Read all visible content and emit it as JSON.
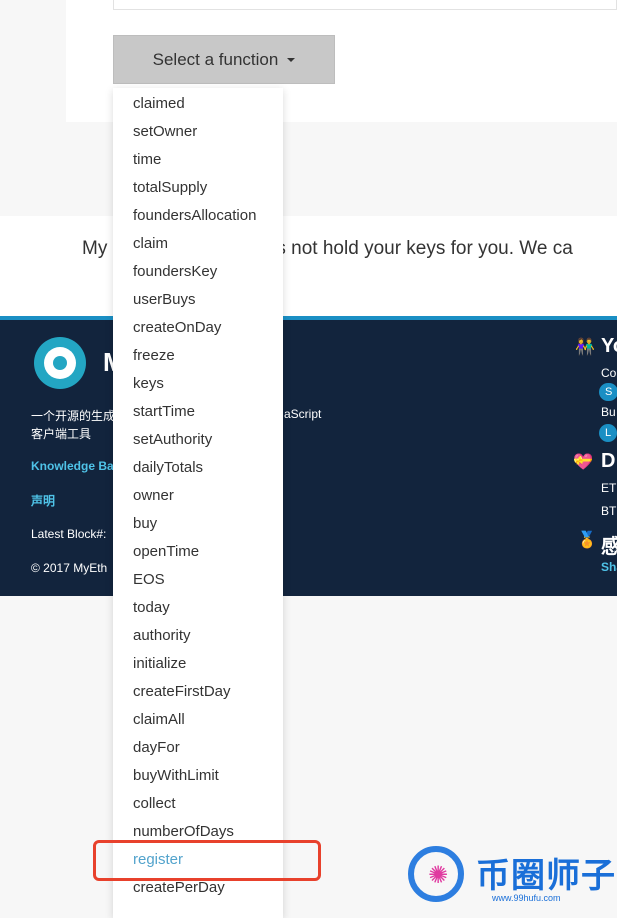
{
  "function_selector": {
    "label": "Select a function"
  },
  "band": {
    "visible_start": "My",
    "visible_end": "oes not hold your keys for you. We ca"
  },
  "footer": {
    "brand_initial": "M",
    "desc_line1": "一个开源的生成",
    "desc_line1_end": "aScript",
    "desc_line2": "客户端工具",
    "knowledge_base": "Knowledge Bas",
    "disclaimer": "声明",
    "latest_block": "Latest Block#: ",
    "copyright": "© 2017 MyEth",
    "right": {
      "heading1": "Yo",
      "co": "Co",
      "pill1": "S",
      "buy": "Bu",
      "pill2": "L",
      "heading2": "D",
      "eth": "ET",
      "btc": "BT",
      "heading3": "感",
      "sha": "Sha"
    }
  },
  "dropdown": {
    "items": [
      "claimed",
      "setOwner",
      "time",
      "totalSupply",
      "foundersAllocation",
      "claim",
      "foundersKey",
      "userBuys",
      "createOnDay",
      "freeze",
      "keys",
      "startTime",
      "setAuthority",
      "dailyTotals",
      "owner",
      "buy",
      "openTime",
      "EOS",
      "today",
      "authority",
      "initialize",
      "createFirstDay",
      "claimAll",
      "dayFor",
      "buyWithLimit",
      "collect",
      "numberOfDays",
      "register",
      "createPerDay"
    ],
    "selected": "register"
  },
  "watermark": {
    "text": "币圈师子",
    "url": "www.99hufu.com"
  },
  "colors": {
    "footer_bg": "#12243d",
    "accent": "#1a8fc4",
    "highlight_border": "#e8412c",
    "selected_item": "#52a3cc"
  }
}
